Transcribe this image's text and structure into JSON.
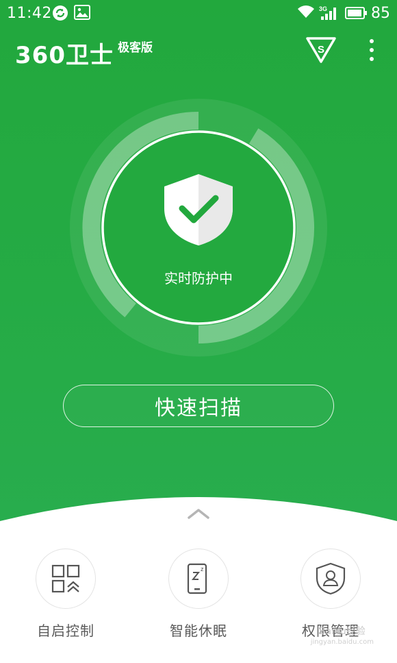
{
  "status_bar": {
    "time": "11:42",
    "battery": "85",
    "network": "3G",
    "icons": [
      "sync-icon",
      "image-icon",
      "wifi-icon",
      "signal-icon",
      "battery-icon"
    ]
  },
  "header": {
    "app_name": "360卫士",
    "edition": "极客版",
    "icons": [
      "shield-s-icon",
      "more-vertical-icon"
    ]
  },
  "protection": {
    "status": "实时防护中",
    "shield_icon": "shield-check-icon"
  },
  "scan_button": {
    "label": "快速扫描"
  },
  "features": [
    {
      "label": "自启控制",
      "icon": "autostart-grid-icon"
    },
    {
      "label": "智能休眠",
      "icon": "phone-sleep-icon"
    },
    {
      "label": "权限管理",
      "icon": "shield-user-icon"
    }
  ],
  "watermark": {
    "text": "Baidu经验",
    "sub": "jingyan.baidu.com"
  },
  "colors": {
    "primary_green": "#22a83d",
    "white": "#ffffff",
    "label_gray": "#5a5a5a",
    "border_gray": "#e3e3e3"
  }
}
